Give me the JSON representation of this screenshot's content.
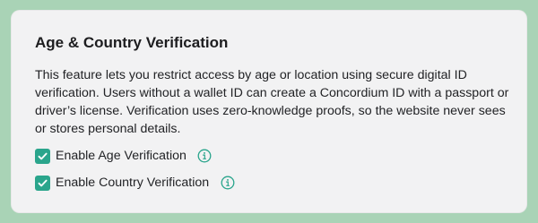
{
  "card": {
    "title": "Age & Country Verification",
    "description": "This feature lets you restrict access by age or location using secure digital ID verification. Users without a wallet ID can create a Concordium ID with a passport or driver’s license. Verification uses zero-knowledge proofs, so the website never sees or stores personal details."
  },
  "options": [
    {
      "label": "Enable Age Verification",
      "checked": true,
      "icon": "info-icon"
    },
    {
      "label": "Enable Country Verification",
      "checked": true,
      "icon": "info-icon"
    }
  ],
  "colors": {
    "background": "#a9d3b6",
    "card": "#f2f2f3",
    "accent": "#2aa58c"
  }
}
